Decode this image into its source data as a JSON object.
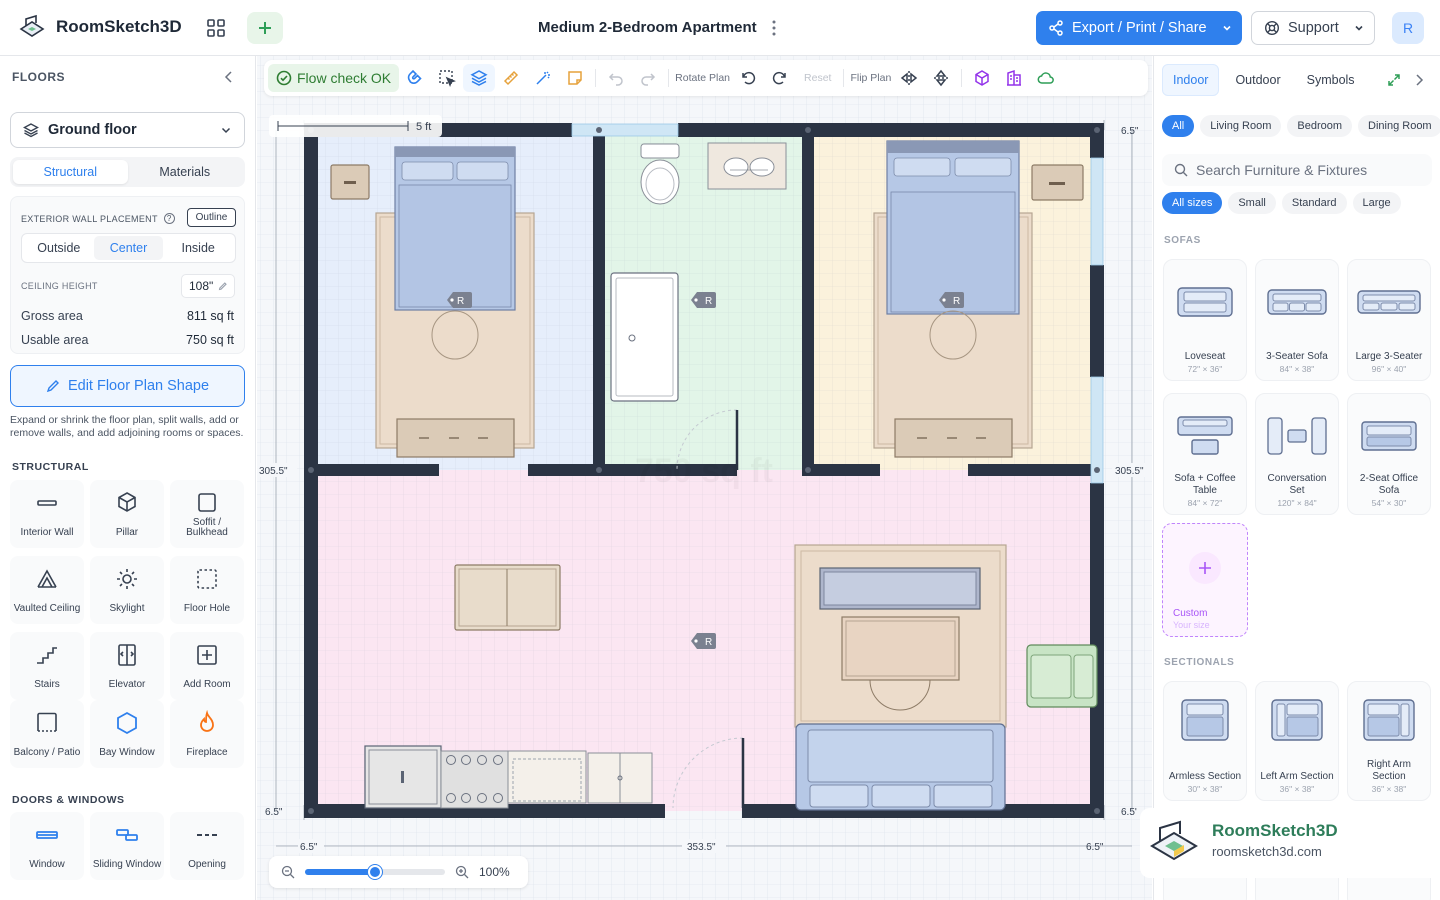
{
  "app": {
    "name": "RoomSketch3D",
    "title": "Medium 2-Bedroom Apartment"
  },
  "header": {
    "export_label": "Export / Print / Share",
    "support_label": "Support",
    "avatar_initial": "R"
  },
  "left": {
    "heading": "FLOORS",
    "floor_selected": "Ground floor",
    "tabs": [
      {
        "label": "Structural",
        "active": true
      },
      {
        "label": "Materials",
        "active": false
      }
    ],
    "wall_placement": {
      "label": "EXTERIOR WALL PLACEMENT",
      "help": "?",
      "outline_label": "Outline",
      "options": [
        {
          "label": "Outside"
        },
        {
          "label": "Center",
          "active": true
        },
        {
          "label": "Inside"
        }
      ]
    },
    "ceiling": {
      "label": "CEILING HEIGHT",
      "value": "108\""
    },
    "gross": {
      "label": "Gross area",
      "value": "811 sq ft"
    },
    "usable": {
      "label": "Usable area",
      "value": "750 sq ft"
    },
    "edit_label": "Edit Floor Plan Shape",
    "help_text": "Expand or shrink the floor plan, split walls, add or remove walls, and add adjoining rooms or spaces.",
    "structural_heading": "STRUCTURAL",
    "structural_items": [
      {
        "label": "Interior Wall",
        "icon": "interior-wall-icon"
      },
      {
        "label": "Pillar",
        "icon": "pillar-icon"
      },
      {
        "label": "Soffit / Bulkhead",
        "icon": "soffit-icon"
      },
      {
        "label": "Vaulted Ceiling",
        "icon": "vaulted-ceiling-icon"
      },
      {
        "label": "Skylight",
        "icon": "skylight-icon"
      },
      {
        "label": "Floor Hole",
        "icon": "floor-hole-icon"
      },
      {
        "label": "Stairs",
        "icon": "stairs-icon"
      },
      {
        "label": "Elevator",
        "icon": "elevator-icon"
      },
      {
        "label": "Add Room",
        "icon": "add-room-icon"
      },
      {
        "label": "Balcony / Patio",
        "icon": "balcony-icon"
      },
      {
        "label": "Bay Window",
        "icon": "bay-window-icon"
      },
      {
        "label": "Fireplace",
        "icon": "fireplace-icon"
      }
    ],
    "dw_heading": "DOORS & WINDOWS",
    "dw_items": [
      {
        "label": "Window",
        "icon": "window-icon"
      },
      {
        "label": "Sliding Window",
        "icon": "sliding-window-icon"
      },
      {
        "label": "Opening",
        "icon": "opening-icon"
      }
    ]
  },
  "toolbar": {
    "flow_check": "Flow check OK",
    "rotate_label": "Rotate Plan",
    "reset_label": "Reset",
    "flip_label": "Flip Plan"
  },
  "canvas": {
    "scale_label": "5 ft",
    "dims": {
      "top": "6.5\"",
      "right_top": "6.5\"",
      "left_mid": "305.5\"",
      "right_mid": "305.5\"",
      "left_bottom": "6.5\"",
      "right_bottom": "6.5'",
      "bottom_left": "6.5\"",
      "bottom_mid": "353.5\"",
      "bottom_right": "6.5\""
    },
    "area_watermark": "750 sq ft",
    "room_badge": "R",
    "zoom_value": "100%",
    "zoom_fraction": 0.5
  },
  "right": {
    "tabs": [
      {
        "label": "Indoor",
        "active": true
      },
      {
        "label": "Outdoor"
      },
      {
        "label": "Symbols"
      }
    ],
    "rooms": [
      {
        "label": "All",
        "active": true
      },
      {
        "label": "Living Room"
      },
      {
        "label": "Bedroom"
      },
      {
        "label": "Dining Room"
      }
    ],
    "search_placeholder": "Search Furniture & Fixtures",
    "sizes": [
      {
        "label": "All sizes",
        "active": true
      },
      {
        "label": "Small"
      },
      {
        "label": "Standard"
      },
      {
        "label": "Large"
      }
    ],
    "sofas_heading": "SOFAS",
    "sofas": [
      {
        "name": "Loveseat",
        "size": "72\" × 36\""
      },
      {
        "name": "3-Seater Sofa",
        "size": "84\" × 38\""
      },
      {
        "name": "Large 3-Seater",
        "size": "96\" × 40\""
      },
      {
        "name": "Sofa + Coffee Table",
        "size": "84\" × 72\""
      },
      {
        "name": "Conversation Set",
        "size": "120\" × 84\""
      },
      {
        "name": "2-Seat Office Sofa",
        "size": "54\" × 30\""
      }
    ],
    "custom": {
      "label": "Custom",
      "sub": "Your size"
    },
    "sectionals_heading": "SECTIONALS",
    "sectionals": [
      {
        "name": "Armless Section",
        "size": "30\" × 38\""
      },
      {
        "name": "Left Arm Section",
        "size": "36\" × 38\""
      },
      {
        "name": "Right Arm Section",
        "size": "36\" × 38\""
      }
    ]
  },
  "watermark": {
    "name": "RoomSketch3D",
    "url": "roomsketch3d.com"
  },
  "colors": {
    "accent": "#2f80ed",
    "success": "#2e7d32",
    "wall": "#2b3444",
    "bedroom_left": "#e6eefb",
    "bathroom": "#e2f5e8",
    "bedroom_right": "#fbf2dc",
    "living": "#fbe6f2"
  }
}
